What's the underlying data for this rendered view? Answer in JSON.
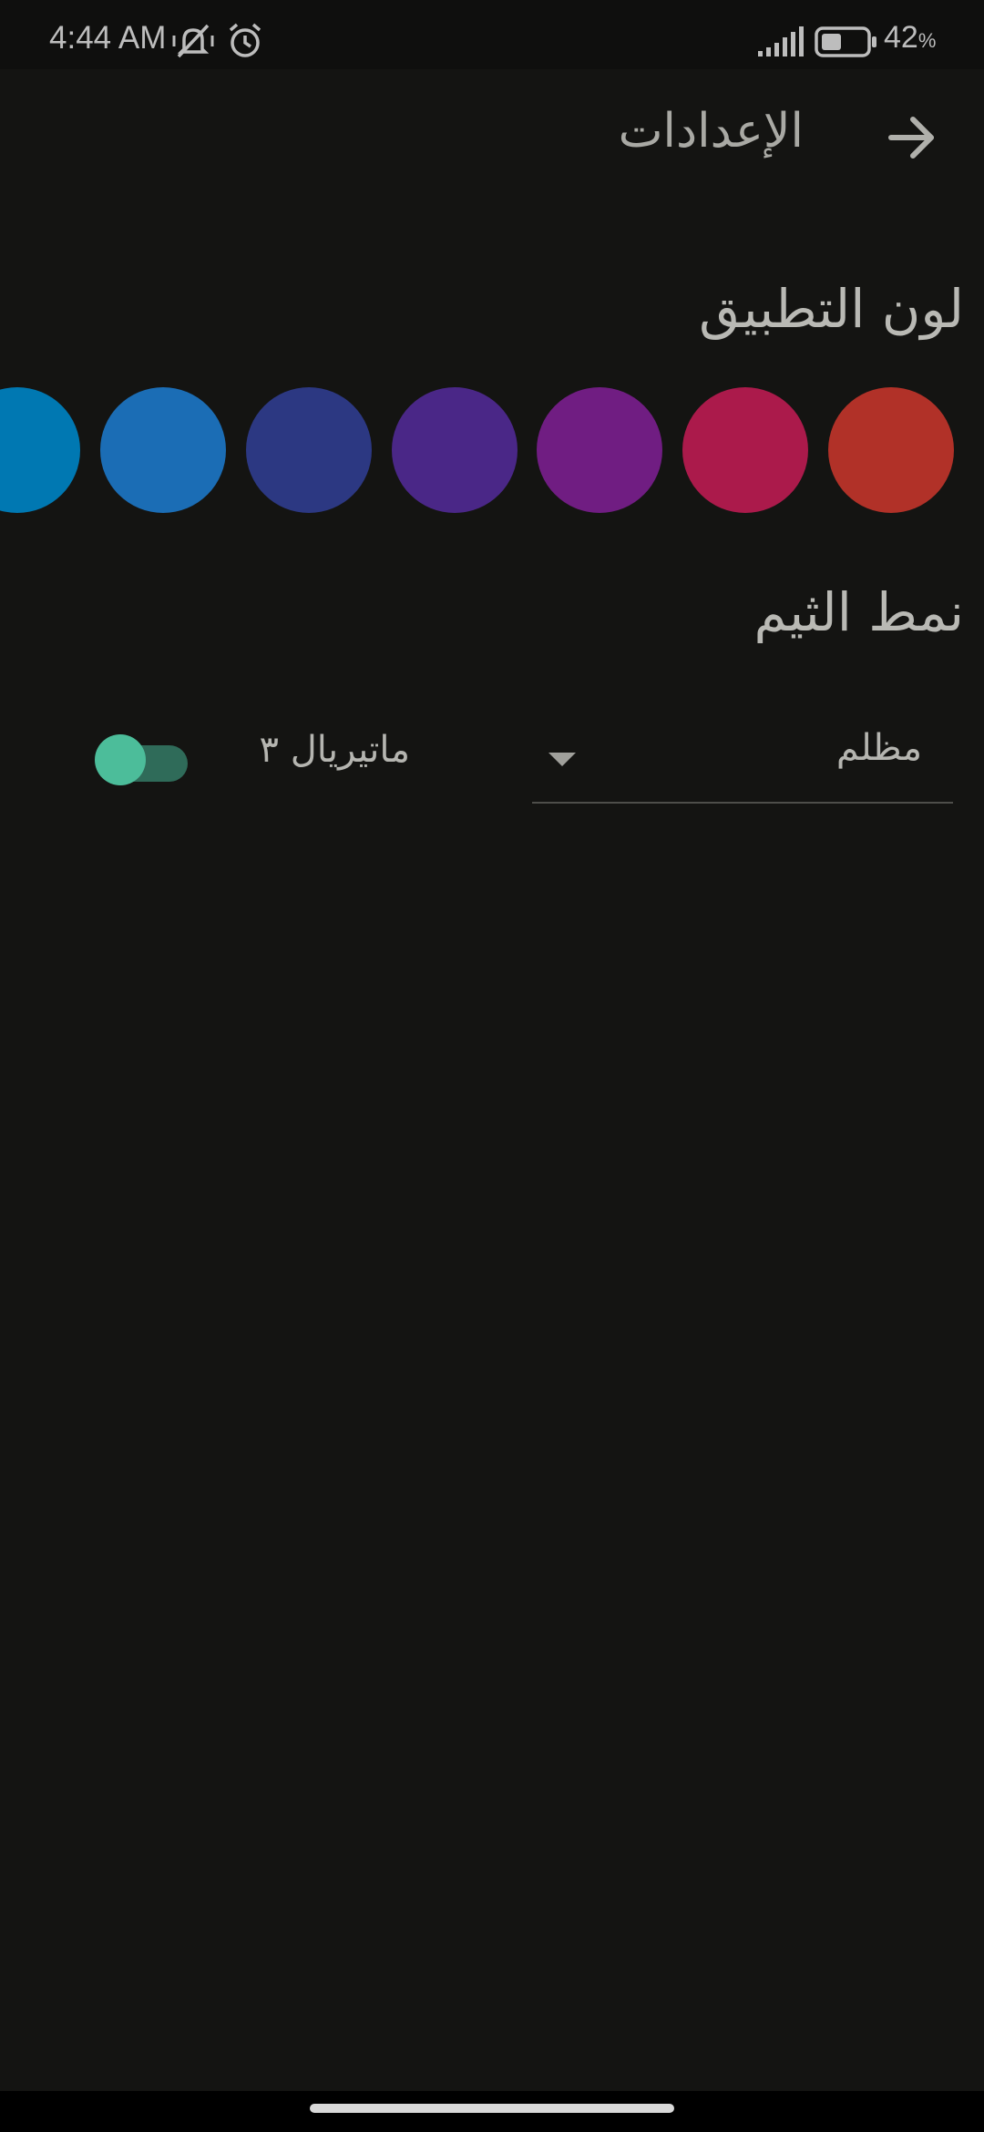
{
  "status_bar": {
    "time": "4:44 AM",
    "battery_percent": "42",
    "battery_unit": "%",
    "battery_level": 0.42,
    "icons": [
      "mute-vibrate-icon",
      "alarm-icon",
      "signal-icon",
      "battery-icon"
    ]
  },
  "app_bar": {
    "title": "الإعدادات",
    "back_icon": "arrow-right-icon"
  },
  "app_color": {
    "heading": "لون التطبيق",
    "swatches": [
      "#b13128",
      "#ab1a4b",
      "#701d82",
      "#4a2787",
      "#2c3882",
      "#1b6db5",
      "#0078b2"
    ]
  },
  "theme": {
    "heading": "نمط الثيم",
    "mode_value": "مظلم",
    "material_label": "ماتيريال ٣",
    "material_enabled": true
  },
  "colors": {
    "background": "#141412",
    "accent": "#4cbd9a"
  }
}
